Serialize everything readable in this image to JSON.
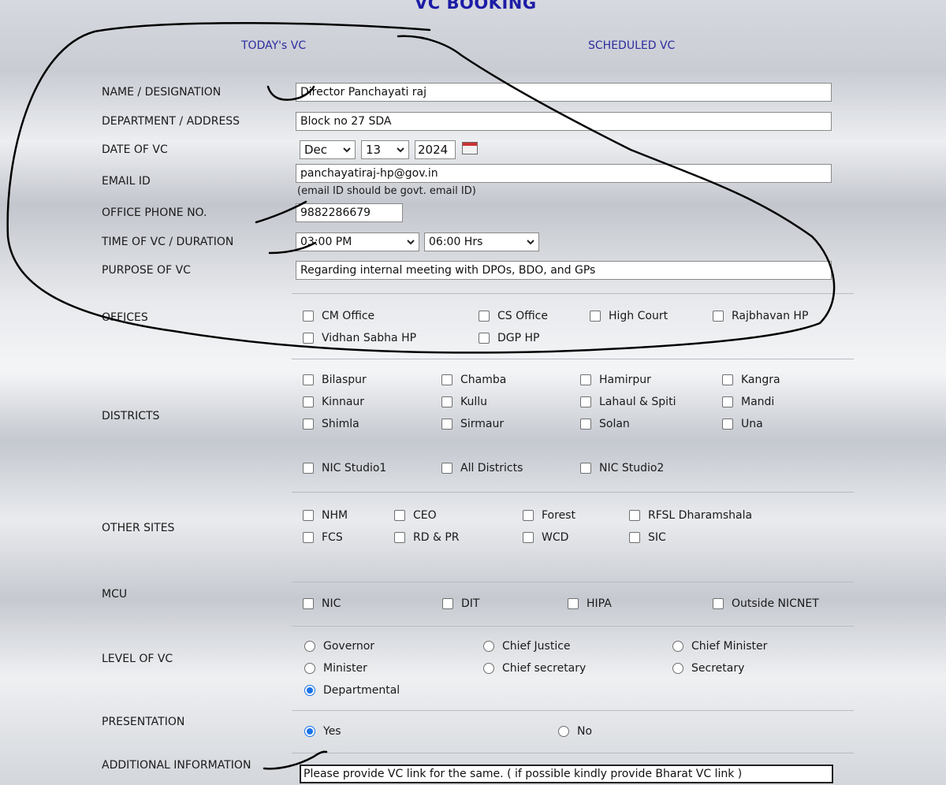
{
  "page": {
    "title": "VC BOOKING"
  },
  "tabs": [
    {
      "label": "TODAY's VC"
    },
    {
      "label": "SCHEDULED VC"
    }
  ],
  "form": {
    "name_label": "NAME / DESIGNATION",
    "name_value": "Director Panchayati raj",
    "dept_label": "DEPARTMENT / ADDRESS",
    "dept_value": "Block no 27 SDA",
    "date_label": "DATE OF VC",
    "date_month": "Dec",
    "date_day": "13",
    "date_year": "2024",
    "email_label": "EMAIL ID",
    "email_value": "panchayatiraj-hp@gov.in",
    "email_hint": "(email ID should be govt. email ID)",
    "phone_label": "OFFICE PHONE NO.",
    "phone_value": "9882286679",
    "time_label": "TIME OF VC / DURATION",
    "time_value": "03:00 PM",
    "duration_value": "06:00 Hrs",
    "purpose_label": "PURPOSE OF VC",
    "purpose_value": "Regarding internal meeting with DPOs, BDO, and GPs",
    "offices_label": "OFFICES",
    "offices": [
      "CM Office",
      "CS Office",
      "High Court",
      "Rajbhavan HP",
      "Vidhan Sabha HP",
      "DGP HP"
    ],
    "districts_label": "DISTRICTS",
    "districts": [
      "Bilaspur",
      "Chamba",
      "Hamirpur",
      "Kangra",
      "Kinnaur",
      "Kullu",
      "Lahaul & Spiti",
      "Mandi",
      "Shimla",
      "Sirmaur",
      "Solan",
      "Una",
      "NIC Studio1",
      "All Districts",
      "NIC Studio2"
    ],
    "other_sites_label": "OTHER SITES",
    "other_sites": [
      "NHM",
      "CEO",
      "Forest",
      "RFSL Dharamshala",
      "FCS",
      "RD & PR",
      "WCD",
      "SIC"
    ],
    "mcu_label": "MCU",
    "mcu": [
      "NIC",
      "DIT",
      "HIPA",
      "Outside NICNET"
    ],
    "level_label": "LEVEL OF VC",
    "levels": [
      "Governor",
      "Chief Justice",
      "Chief Minister",
      "Minister",
      "Chief secretary",
      "Secretary",
      "Departmental"
    ],
    "level_selected": "Departmental",
    "presentation_label": "PRESENTATION",
    "presentation_options": [
      "Yes",
      "No"
    ],
    "presentation_selected": "Yes",
    "additional_label": "ADDITIONAL INFORMATION",
    "additional_value": "Please provide VC link for the same. ( if possible kindly provide Bharat VC link )"
  },
  "colors": {
    "title": "#1c1ca6",
    "tab": "#2c2c9e",
    "radio_selected": "#1a73e8",
    "ink": "#000000"
  }
}
